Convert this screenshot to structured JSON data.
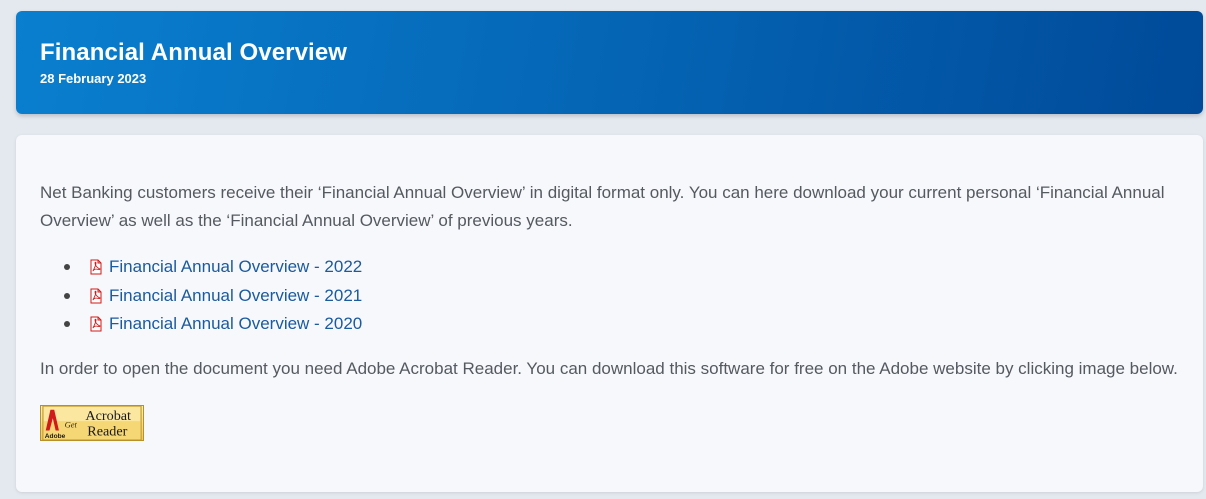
{
  "header": {
    "title": "Financial Annual Overview",
    "date": "28 February 2023"
  },
  "main": {
    "intro": "Net Banking customers receive their ‘Financial Annual Overview’ in digital format only. You can here download your current personal ‘Financial Annual Overview’ as well as the ‘Financial Annual Overview’ of previous years.",
    "documents": [
      {
        "label": "Financial Annual Overview - 2022",
        "icon": "pdf-icon"
      },
      {
        "label": "Financial Annual Overview - 2021",
        "icon": "pdf-icon"
      },
      {
        "label": "Financial Annual Overview - 2020",
        "icon": "pdf-icon"
      }
    ],
    "reader_note": "In order to open the document you need Adobe Acrobat Reader. You can download this software for free on the Adobe website by clicking image below.",
    "adobe_badge": {
      "brand": "Adobe",
      "get": "Get",
      "line1": "Acrobat",
      "line2": "Reader"
    }
  },
  "colors": {
    "header_gradient_start": "#0a7fcf",
    "header_gradient_end": "#004a99",
    "link": "#1a5aa0",
    "body_text": "#555a60",
    "page_background": "#e4e8ef",
    "pdf_red": "#d11a1a"
  }
}
